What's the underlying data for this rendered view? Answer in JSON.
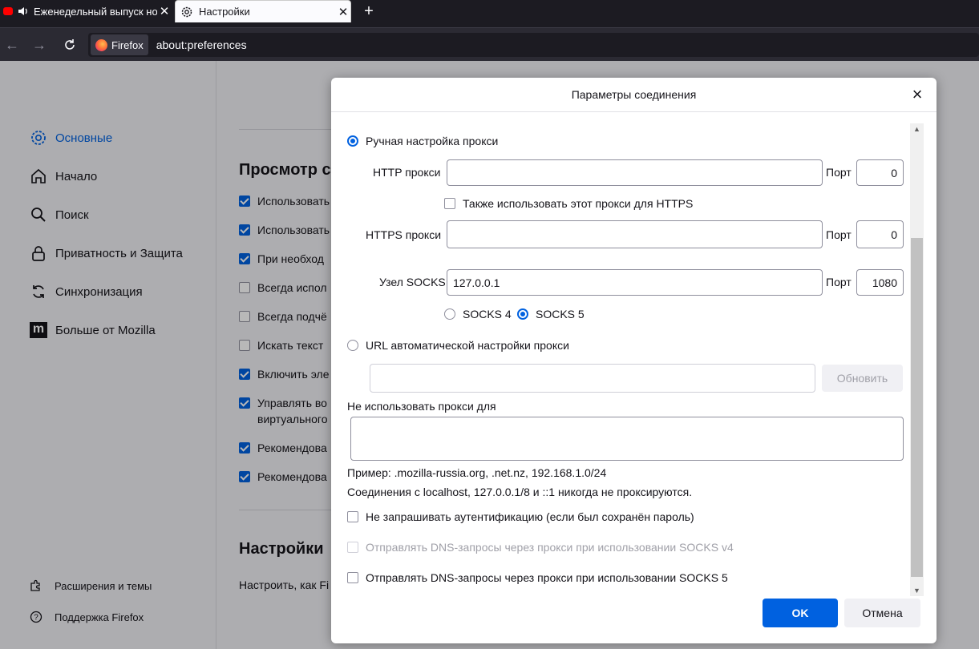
{
  "tabs": [
    {
      "label": "Еженедельный выпуск нов",
      "active": false
    },
    {
      "label": "Настройки",
      "active": true
    }
  ],
  "navbar": {
    "identity_label": "Firefox",
    "url": "about:preferences"
  },
  "sidebar": {
    "items": [
      {
        "label": "Основные",
        "icon": "gear-icon",
        "selected": true
      },
      {
        "label": "Начало",
        "icon": "home-icon"
      },
      {
        "label": "Поиск",
        "icon": "search-icon"
      },
      {
        "label": "Приватность и Защита",
        "icon": "lock-icon"
      },
      {
        "label": "Синхронизация",
        "icon": "sync-icon"
      },
      {
        "label": "Больше от Mozilla",
        "icon": "mozilla-icon"
      }
    ],
    "footer": [
      {
        "label": "Расширения и темы",
        "icon": "puzzle-icon"
      },
      {
        "label": "Поддержка Firefox",
        "icon": "help-icon"
      }
    ]
  },
  "content": {
    "heading_browse": "Просмотр с",
    "checkboxes": [
      {
        "label": "Использовать",
        "checked": true
      },
      {
        "label": "Использовать",
        "checked": true
      },
      {
        "label": "При необход",
        "checked": true
      },
      {
        "label": "Всегда испол",
        "checked": false
      },
      {
        "label": "Всегда подчё",
        "checked": false
      },
      {
        "label": "Искать текст",
        "checked": false
      },
      {
        "label": "Включить эле",
        "checked": true
      },
      {
        "label": "Управлять во",
        "label2": "виртуального",
        "checked": true
      },
      {
        "label": "Рекомендова",
        "checked": true
      },
      {
        "label": "Рекомендова",
        "checked": true
      }
    ],
    "heading_settings": "Настройки",
    "settings_text": "Настроить, как Fi"
  },
  "dialog": {
    "title": "Параметры соединения",
    "manual_proxy_label": "Ручная настройка прокси",
    "http_proxy_label": "HTTP прокси",
    "http_proxy_value": "",
    "port_label": "Порт",
    "http_port": "0",
    "also_https_label": "Также использовать этот прокси для HTTPS",
    "https_proxy_label": "HTTPS прокси",
    "https_proxy_value": "",
    "https_port": "0",
    "socks_host_label": "Узел SOCKS",
    "socks_host_value": "127.0.0.1",
    "socks_port": "1080",
    "socks4_label": "SOCKS 4",
    "socks5_label": "SOCKS 5",
    "auto_url_label": "URL автоматической настройки прокси",
    "auto_url_value": "",
    "reload_label": "Обновить",
    "no_proxy_label": "Не использовать прокси для",
    "no_proxy_value": "",
    "example_text": "Пример: .mozilla-russia.org, .net.nz, 192.168.1.0/24",
    "localhost_text": "Соединения с localhost, 127.0.0.1/8 и ::1 никогда не проксируются.",
    "no_auth_label": "Не запрашивать аутентификацию (если был сохранён пароль)",
    "dns_v4_label": "Отправлять DNS-запросы через прокси при использовании SOCKS v4",
    "dns_v5_label": "Отправлять DNS-запросы через прокси при использовании SOCKS 5",
    "ok_label": "OK",
    "cancel_label": "Отмена"
  },
  "colors": {
    "accent": "#0061e0",
    "chrome_dark": "#1c1b22",
    "page_bg": "#f0f0f4"
  }
}
